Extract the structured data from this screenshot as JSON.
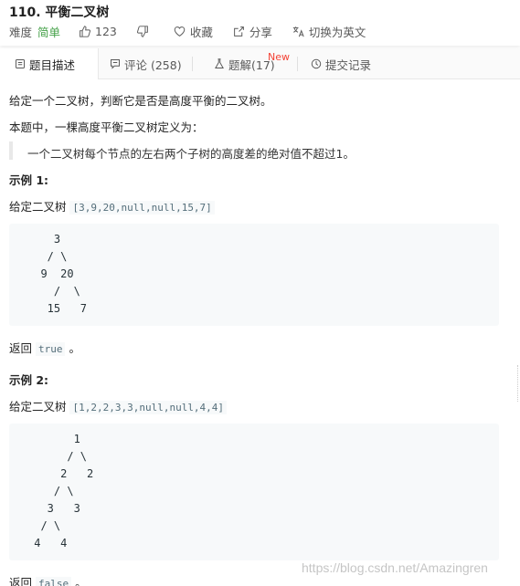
{
  "problem": {
    "title": "110. 平衡二叉树",
    "difficulty_label": "难度",
    "difficulty": "简单",
    "likes": "123",
    "collect": "收藏",
    "share": "分享",
    "switch_lang": "切换为英文"
  },
  "tabs": [
    {
      "label": "题目描述"
    },
    {
      "label": "评论 (258)"
    },
    {
      "label": "题解(17)"
    },
    {
      "label": "提交记录"
    }
  ],
  "new_badge": "New",
  "description": {
    "intro": "给定一个二叉树，判断它是否是高度平衡的二叉树。",
    "definition_lead": "本题中，一棵高度平衡二叉树定义为：",
    "definition": "一个二叉树每个节点的左右两个子树的高度差的绝对值不超过1。"
  },
  "examples": [
    {
      "heading": "示例 1:",
      "given_prefix": "给定二叉树 ",
      "given_value": "[3,9,20,null,null,15,7]",
      "tree_lines": [
        "    3",
        "   / \\",
        "  9  20",
        "    /  \\",
        "   15   7"
      ],
      "return_prefix": "返回 ",
      "return_value": "true",
      "return_suffix": " 。"
    },
    {
      "heading": "示例 2:",
      "given_prefix": "给定二叉树 ",
      "given_value": "[1,2,2,3,3,null,null,4,4]",
      "tree_lines": [
        "       1",
        "      / \\",
        "     2   2",
        "    / \\",
        "   3   3",
        "  / \\",
        " 4   4"
      ],
      "return_prefix": "返回 ",
      "return_value": "false",
      "return_suffix": " 。"
    }
  ],
  "watermark": "https://blog.csdn.net/Amazingren"
}
